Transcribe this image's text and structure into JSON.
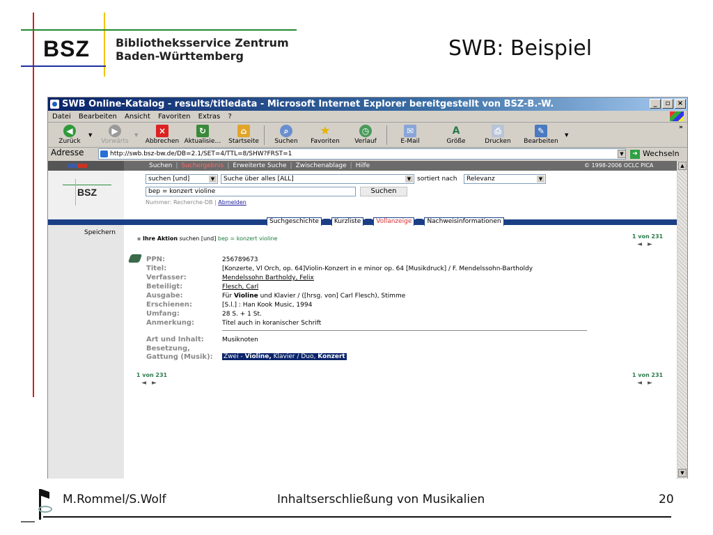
{
  "slide": {
    "logo": "BSZ",
    "org_line1": "Bibliotheksservice Zentrum",
    "org_line2": "Baden-Württemberg",
    "title": "SWB: Beispiel",
    "footer_authors": "M.Rommel/S.Wolf",
    "footer_topic": "Inhaltserschließung von Musikalien",
    "page_number": "20"
  },
  "browser": {
    "window_title": "SWB Online-Katalog - results/titledata - Microsoft Internet Explorer bereitgestellt von BSZ-B.-W.",
    "window_buttons": [
      "_",
      "▫",
      "×"
    ],
    "menu": [
      "Datei",
      "Bearbeiten",
      "Ansicht",
      "Favoriten",
      "Extras",
      "?"
    ],
    "toolbar": {
      "back": "Zurück",
      "forward": "Vorwärts",
      "stop": "Abbrechen",
      "refresh": "Aktualisie…",
      "home": "Startseite",
      "search": "Suchen",
      "favorites": "Favoriten",
      "history": "Verlauf",
      "mail": "E-Mail",
      "size": "Größe",
      "print": "Drucken",
      "edit": "Bearbeiten"
    },
    "address_label": "Adresse",
    "address_value": "http://swb.bsz-bw.de/DB=2.1/SET=4/TTL=8/SHW?FRST=1",
    "go_label": "Wechseln zu"
  },
  "catalog": {
    "nav": {
      "items": [
        "Suchen",
        "Suchergebnis",
        "Erweiterte Suche",
        "Zwischenablage",
        "Hilfe"
      ],
      "copyright": "© 1998-2006 OCLC PICA"
    },
    "left_logo": "BSZ",
    "search": {
      "mode_select": "suchen [und]",
      "index_select": "Suche über alles [ALL]",
      "sort_label": "sortiert nach",
      "sort_select": "Relevanz",
      "query_value": "bep = konzert violine",
      "search_button": "Suchen",
      "db_info": "Nummer: Recherche-DB |",
      "logout_link": "Abmelden"
    },
    "tabs": [
      "Suchgeschichte",
      "Kurzliste",
      "Vollanzeige",
      "Nachweisinformationen"
    ],
    "left_save": "Speichern",
    "action": {
      "label": "Ihre Aktion",
      "text": "suchen [und]",
      "query": "bep = konzert violine"
    },
    "pager": {
      "text": "1 von 231",
      "prev": "◄",
      "next": "►"
    },
    "record": {
      "ppn_label": "PPN:",
      "ppn_value": "256789673",
      "title_label": "Titel:",
      "title_value": "[Konzerte, Vl Orch, op. 64]Violin-Konzert in e minor op. 64 [Musikdruck] / F. Mendelssohn-Bartholdy",
      "author_label": "Verfasser:",
      "author_value": "Mendelssohn Bartholdy, Felix",
      "contrib_label": "Beteiligt:",
      "contrib_value": "Flesch, Carl",
      "edition_label": "Ausgabe:",
      "edition_pre": "Für",
      "edition_bold": "Violine",
      "edition_post": "und Klavier / ([hrsg. von] Carl Flesch), Stimme",
      "pub_label": "Erschienen:",
      "pub_value": "[S.l.] : Han Kook Music, 1994",
      "extent_label": "Umfang:",
      "extent_value": "28 S. + 1 St.",
      "note_label": "Anmerkung:",
      "note_value": "Titel auch in koranischer Schrift",
      "type_label": "Art und Inhalt:",
      "type_value": "Musiknoten",
      "genre_label1": "Besetzung,",
      "genre_label2": "Gattung (Musik):",
      "genre_pre": "Zwei -",
      "genre_bold1": "Violine,",
      "genre_mid": "Klavier / Duo,",
      "genre_bold2": "Konzert"
    }
  }
}
